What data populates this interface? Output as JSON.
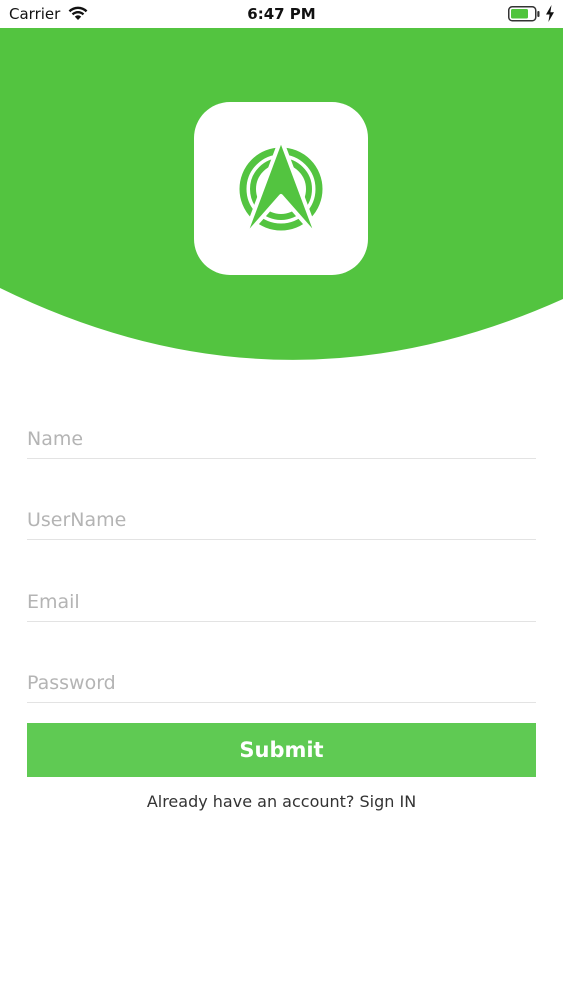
{
  "status_bar": {
    "carrier": "Carrier",
    "time": "6:47 PM",
    "wifi_icon": "wifi-icon",
    "battery_icon": "battery-icon",
    "charging_icon": "charging-bolt-icon"
  },
  "header": {
    "background_color": "#53c440",
    "logo_icon": "navigation-arrow-logo-icon"
  },
  "form": {
    "name_placeholder": "Name",
    "username_placeholder": "UserName",
    "email_placeholder": "Email",
    "password_placeholder": "Password",
    "submit_label": "Submit",
    "submit_color": "#5fca53"
  },
  "footer": {
    "prompt": "Already have an account?",
    "signin_link": "Sign IN"
  }
}
